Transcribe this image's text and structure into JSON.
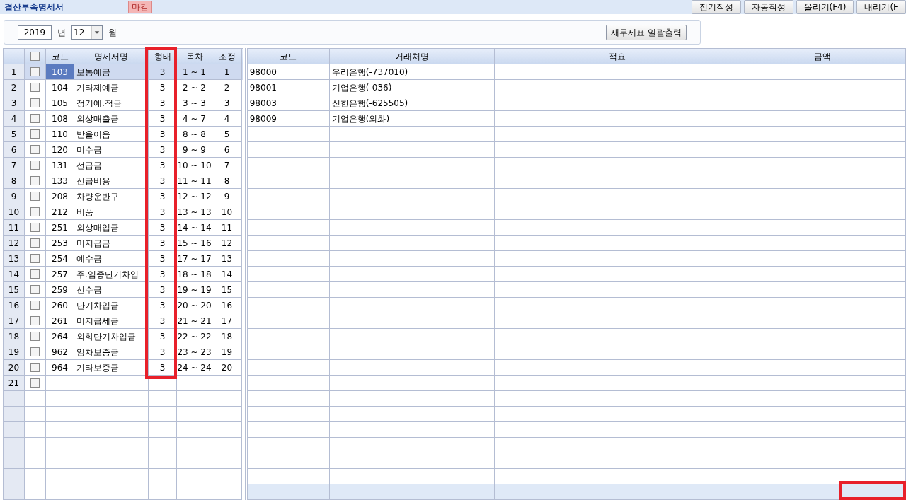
{
  "window": {
    "title": "결산부속명세서",
    "status_badge": "마감"
  },
  "toolbar": {
    "buttons": [
      "전기작성",
      "자동작성",
      "올리기(F4)",
      "내리기(F"
    ]
  },
  "filter": {
    "year": "2019",
    "year_unit": "년",
    "month": "12",
    "month_unit": "월",
    "print_button": "재무제표 일괄출력"
  },
  "left_table": {
    "all_checked": false,
    "columns": [
      "코드",
      "명세서명",
      "형태",
      "목차",
      "조정"
    ],
    "rows": [
      {
        "no": "1",
        "checked": false,
        "selected": true,
        "code": "103",
        "name": "보통예금",
        "form": "3",
        "range": "1 ~ 1",
        "adjust": "1"
      },
      {
        "no": "2",
        "checked": false,
        "selected": false,
        "code": "104",
        "name": "기타제예금",
        "form": "3",
        "range": "2 ~ 2",
        "adjust": "2"
      },
      {
        "no": "3",
        "checked": false,
        "selected": false,
        "code": "105",
        "name": "정기예.적금",
        "form": "3",
        "range": "3 ~ 3",
        "adjust": "3"
      },
      {
        "no": "4",
        "checked": false,
        "selected": false,
        "code": "108",
        "name": "외상매출금",
        "form": "3",
        "range": "4 ~ 7",
        "adjust": "4"
      },
      {
        "no": "5",
        "checked": false,
        "selected": false,
        "code": "110",
        "name": "받을어음",
        "form": "3",
        "range": "8 ~ 8",
        "adjust": "5"
      },
      {
        "no": "6",
        "checked": false,
        "selected": false,
        "code": "120",
        "name": "미수금",
        "form": "3",
        "range": "9 ~ 9",
        "adjust": "6"
      },
      {
        "no": "7",
        "checked": false,
        "selected": false,
        "code": "131",
        "name": "선급금",
        "form": "3",
        "range": "10 ~ 10",
        "adjust": "7"
      },
      {
        "no": "8",
        "checked": false,
        "selected": false,
        "code": "133",
        "name": "선급비용",
        "form": "3",
        "range": "11 ~ 11",
        "adjust": "8"
      },
      {
        "no": "9",
        "checked": false,
        "selected": false,
        "code": "208",
        "name": "차량운반구",
        "form": "3",
        "range": "12 ~ 12",
        "adjust": "9"
      },
      {
        "no": "10",
        "checked": false,
        "selected": false,
        "code": "212",
        "name": "비품",
        "form": "3",
        "range": "13 ~ 13",
        "adjust": "10"
      },
      {
        "no": "11",
        "checked": false,
        "selected": false,
        "code": "251",
        "name": "외상매입금",
        "form": "3",
        "range": "14 ~ 14",
        "adjust": "11"
      },
      {
        "no": "12",
        "checked": false,
        "selected": false,
        "code": "253",
        "name": "미지급금",
        "form": "3",
        "range": "15 ~ 16",
        "adjust": "12"
      },
      {
        "no": "13",
        "checked": false,
        "selected": false,
        "code": "254",
        "name": "예수금",
        "form": "3",
        "range": "17 ~ 17",
        "adjust": "13"
      },
      {
        "no": "14",
        "checked": false,
        "selected": false,
        "code": "257",
        "name": "주.임종단기차입",
        "form": "3",
        "range": "18 ~ 18",
        "adjust": "14"
      },
      {
        "no": "15",
        "checked": false,
        "selected": false,
        "code": "259",
        "name": "선수금",
        "form": "3",
        "range": "19 ~ 19",
        "adjust": "15"
      },
      {
        "no": "16",
        "checked": false,
        "selected": false,
        "code": "260",
        "name": "단기차입금",
        "form": "3",
        "range": "20 ~ 20",
        "adjust": "16"
      },
      {
        "no": "17",
        "checked": false,
        "selected": false,
        "code": "261",
        "name": "미지급세금",
        "form": "3",
        "range": "21 ~ 21",
        "adjust": "17"
      },
      {
        "no": "18",
        "checked": false,
        "selected": false,
        "code": "264",
        "name": "외화단기차입금",
        "form": "3",
        "range": "22 ~ 22",
        "adjust": "18"
      },
      {
        "no": "19",
        "checked": false,
        "selected": false,
        "code": "962",
        "name": "임차보증금",
        "form": "3",
        "range": "23 ~ 23",
        "adjust": "19"
      },
      {
        "no": "20",
        "checked": false,
        "selected": false,
        "code": "964",
        "name": "기타보증금",
        "form": "3",
        "range": "24 ~ 24",
        "adjust": "20"
      },
      {
        "no": "21",
        "checked": false,
        "selected": false
      }
    ]
  },
  "right_table": {
    "columns": [
      "코드",
      "거래처명",
      "적요",
      "금액"
    ],
    "rows": [
      {
        "code": "98000",
        "name": "우리은행(-737010)"
      },
      {
        "code": "98001",
        "name": "기업은행(-036)"
      },
      {
        "code": "98003",
        "name": "신한은행(-625505)"
      },
      {
        "code": "98009",
        "name": "기업은행(외화)"
      }
    ]
  }
}
